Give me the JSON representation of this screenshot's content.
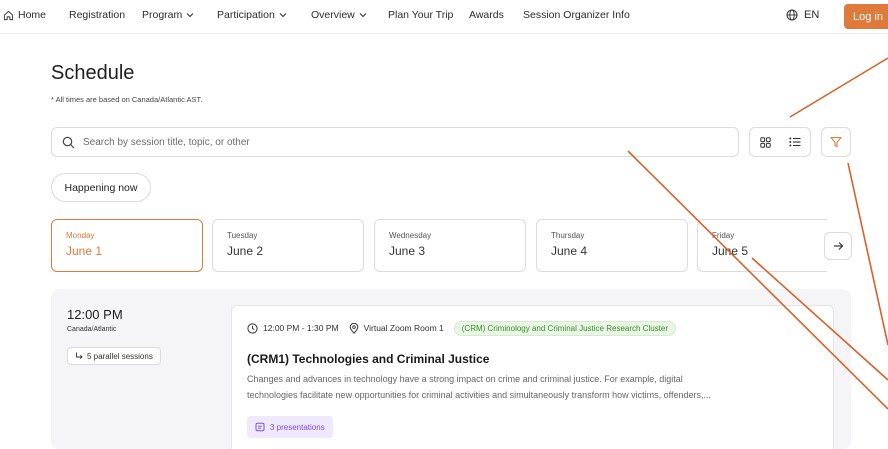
{
  "nav": {
    "home": "Home",
    "items": [
      "Registration",
      "Program",
      "Participation",
      "Overview",
      "Plan Your Trip",
      "Awards",
      "Session Organizer Info"
    ],
    "language": "EN",
    "login": "Log in"
  },
  "page": {
    "title": "Schedule",
    "timezone_note": "* All times are based on Canada/Atlantic AST."
  },
  "search": {
    "placeholder": "Search by session title, topic, or other"
  },
  "happening_now": "Happening now",
  "days": [
    {
      "name": "Monday",
      "date": "June 1"
    },
    {
      "name": "Tuesday",
      "date": "June 2"
    },
    {
      "name": "Wednesday",
      "date": "June 3"
    },
    {
      "name": "Thursday",
      "date": "June 4"
    },
    {
      "name": "Friday",
      "date": "June 5"
    }
  ],
  "slot": {
    "time": "12:00 PM",
    "timezone": "Canada/Atlantic",
    "parallel": "5 parallel sessions"
  },
  "session": {
    "time_range": "12:00 PM - 1:30 PM",
    "room": "Virtual Zoom Room 1",
    "tag": "(CRM) Criminology and Criminal Justice Research Cluster",
    "title": "(CRM1) Technologies and Criminal Justice",
    "desc_line1": "Changes and advances in technology have a strong impact on crime and criminal justice. For example, digital",
    "desc_line2": "technologies facilitate new opportunities for criminal activities and simultaneously transform how victims, offenders,...",
    "presentations": "3 presentations"
  },
  "colors": {
    "accent": "#e07a3a",
    "tag_green": "#3d8a2f",
    "purple": "#7a4fd6"
  }
}
